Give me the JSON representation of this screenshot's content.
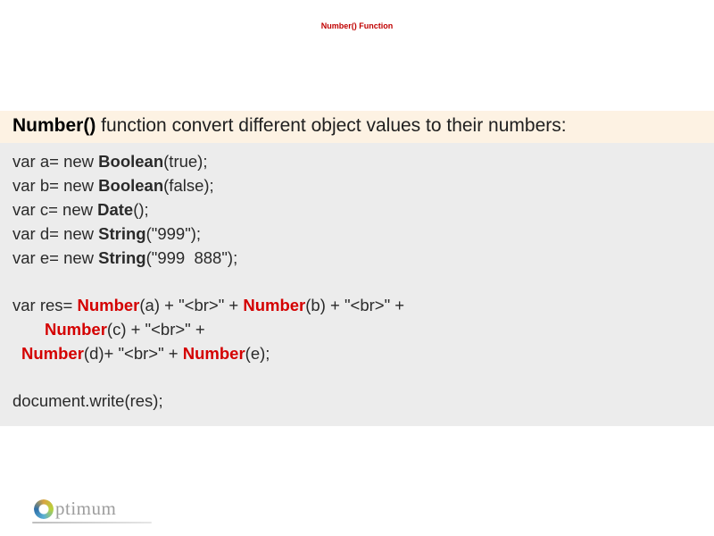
{
  "title": "Number() Function",
  "description": {
    "fn": "Number()",
    "rest": " function convert different object values to their numbers:"
  },
  "code": {
    "l1a": "var a= new ",
    "l1b": "Boolean",
    "l1c": "(true);",
    "l2a": "var b= new ",
    "l2b": "Boolean",
    "l2c": "(false);",
    "l3a": "var c= new ",
    "l3b": "Date",
    "l3c": "();",
    "l4a": "var d= new ",
    "l4b": "String",
    "l4c": "(\"999\");",
    "l5a": "var e= new ",
    "l5b": "String",
    "l5c": "(\"999  888\");",
    "l6a": "var res= ",
    "l6b": "Number",
    "l6c": "(a) + \"<br>\" + ",
    "l6d": "Number",
    "l6e": "(b) + \"<br>\" + ",
    "l7a": "Number",
    "l7b": "(c) + \"<br>\" + ",
    "l8a": "Number",
    "l8b": "(d)+ \"<br>\" + ",
    "l8c": "Number",
    "l8d": "(e);",
    "l9": "document.write(res);"
  },
  "logo": "ptimum"
}
